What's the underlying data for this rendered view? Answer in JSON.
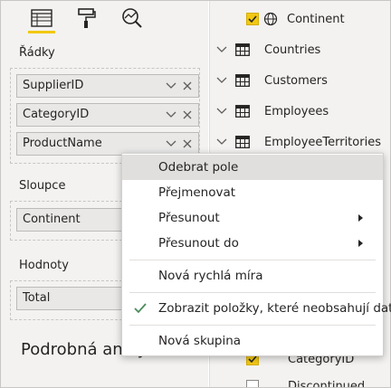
{
  "left": {
    "rows_label": "Řádky",
    "rows_fields": [
      {
        "name": "SupplierID"
      },
      {
        "name": "CategoryID"
      },
      {
        "name": "ProductName"
      }
    ],
    "columns_label": "Sloupce",
    "columns_fields": [
      {
        "name": "Continent"
      }
    ],
    "values_label": "Hodnoty",
    "values_fields": [
      {
        "name": "Total"
      }
    ],
    "drillthrough_label": "Podrobná analýza"
  },
  "right": {
    "top_field": "Continent",
    "tables": [
      "Countries",
      "Customers",
      "Employees",
      "EmployeeTerritories"
    ],
    "bottom_field": "CategoryID",
    "bottom_partial": "Discontinued"
  },
  "context_menu": {
    "items": [
      {
        "label": "Odebrat pole"
      },
      {
        "label": "Přejmenovat"
      },
      {
        "label": "Přesunout"
      },
      {
        "label": "Přesunout do"
      },
      {
        "label": "Nová rychlá míra"
      },
      {
        "label": "Zobrazit položky, které neobsahují data"
      },
      {
        "label": "Nová skupina"
      }
    ]
  },
  "colors": {
    "accent": "#f2c811",
    "check": "#4a8c5b",
    "highlight": "#e1dfdd"
  }
}
